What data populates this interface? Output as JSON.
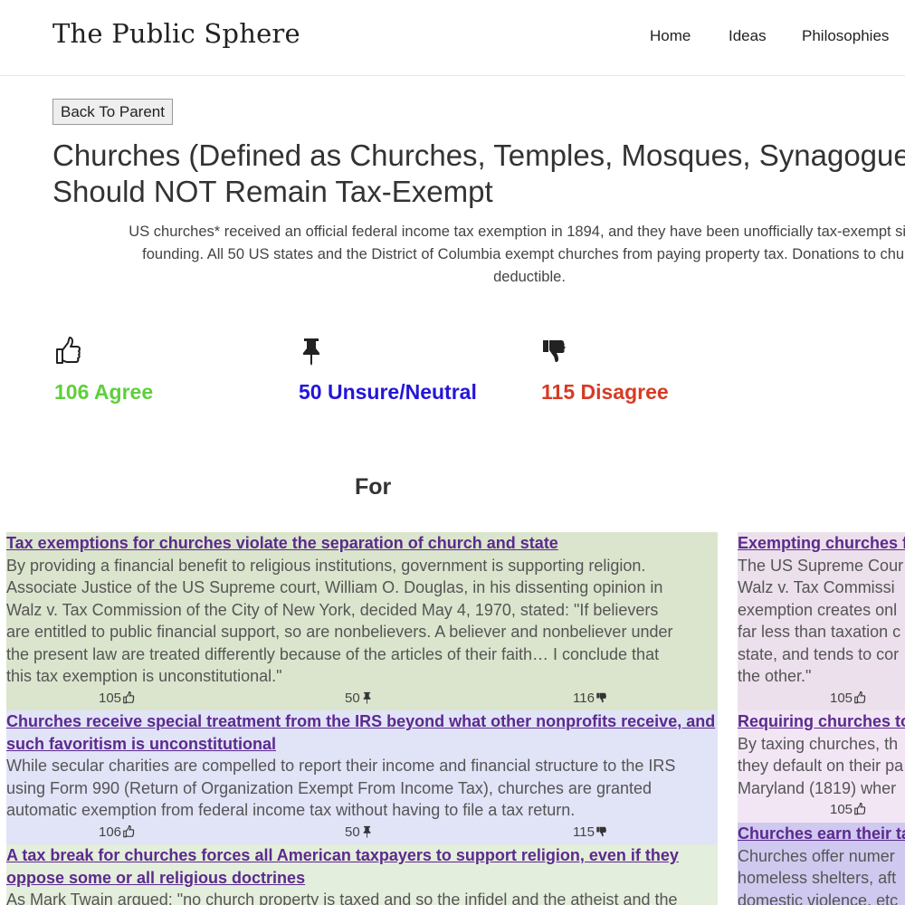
{
  "header": {
    "brand": "The Public Sphere",
    "nav": [
      "Home",
      "Ideas",
      "Philosophies"
    ]
  },
  "back_button": "Back To Parent",
  "title_lines": [
    "Churches (Defined as Churches, Temples, Mosques, Synagogue",
    "Should NOT Remain Tax-Exempt"
  ],
  "description_lines": [
    "US churches* received an official federal income tax exemption in 1894, and they have been unofficially tax-exempt since",
    "founding. All 50 US states and the District of Columbia exempt churches from paying property tax. Donations to churc",
    "deductible."
  ],
  "stats": {
    "agree": {
      "label": "106 Agree",
      "icon": "thumbs-up-icon",
      "color": "#5fcf3b"
    },
    "neutral": {
      "label": "50 Unsure/Neutral",
      "icon": "pushpin-icon",
      "color": "#2415d8"
    },
    "disagree": {
      "label": "115 Disagree",
      "icon": "thumbs-down-icon",
      "color": "#d63b25"
    }
  },
  "for_heading": "For",
  "left_arguments": [
    {
      "title_lines": [
        "Tax exemptions for churches violate the separation of church and state "
      ],
      "body_lines": [
        "By providing a financial benefit to religious institutions, government is supporting religion.",
        "Associate Justice of the US Supreme court, William O. Douglas, in his dissenting opinion in",
        "Walz v. Tax Commission of the City of New York, decided May 4, 1970, stated: \"If believers",
        "are entitled to public financial support, so are nonbelievers. A believer and nonbeliever under",
        "the present law are treated differently because of the articles of their faith… I conclude that",
        "this tax exemption is unconstitutional.\""
      ],
      "agree": "105",
      "neutral": "50",
      "disagree": "116",
      "bg": "#dbe5cd"
    },
    {
      "title_lines": [
        "Churches receive special treatment from the IRS beyond what other nonprofits receive, and",
        "such favoritism is unconstitutional "
      ],
      "body_lines": [
        "While secular charities are compelled to report their income and financial structure to the IRS",
        "using Form 990 (Return of Organization Exempt From Income Tax), churches are granted",
        "automatic exemption from federal income tax without having to file a tax return."
      ],
      "agree": "106",
      "neutral": "50",
      "disagree": "115",
      "bg": "#e1e3f7"
    },
    {
      "title_lines": [
        "A tax break for churches forces all American taxpayers to support religion, even if they",
        "oppose some or all religious doctrines "
      ],
      "body_lines": [
        "As Mark Twain argued: \"no church property is taxed and so the infidel and the atheist and the"
      ],
      "bg": "#e4eedc"
    }
  ],
  "right_arguments": [
    {
      "title_lines": [
        "Exempting churches f"
      ],
      "body_lines": [
        "The US Supreme Cour",
        "Walz v. Tax Commissi",
        "exemption creates onl",
        "far less than taxation c",
        "state, and tends to cor",
        "the other.\""
      ],
      "agree": "105",
      "bg": "#ece0ec"
    },
    {
      "title_lines": [
        "Requiring churches to"
      ],
      "body_lines": [
        "By taxing churches, th",
        "they default on their pa",
        "Maryland (1819) wher"
      ],
      "agree": "105",
      "bg": "#f2e6f5"
    },
    {
      "title_lines": [
        "Churches earn their ta"
      ],
      "body_lines": [
        "Churches offer numer",
        "homeless shelters, aft",
        "domestic violence, etc"
      ],
      "bg": "#cfc9ef"
    }
  ]
}
